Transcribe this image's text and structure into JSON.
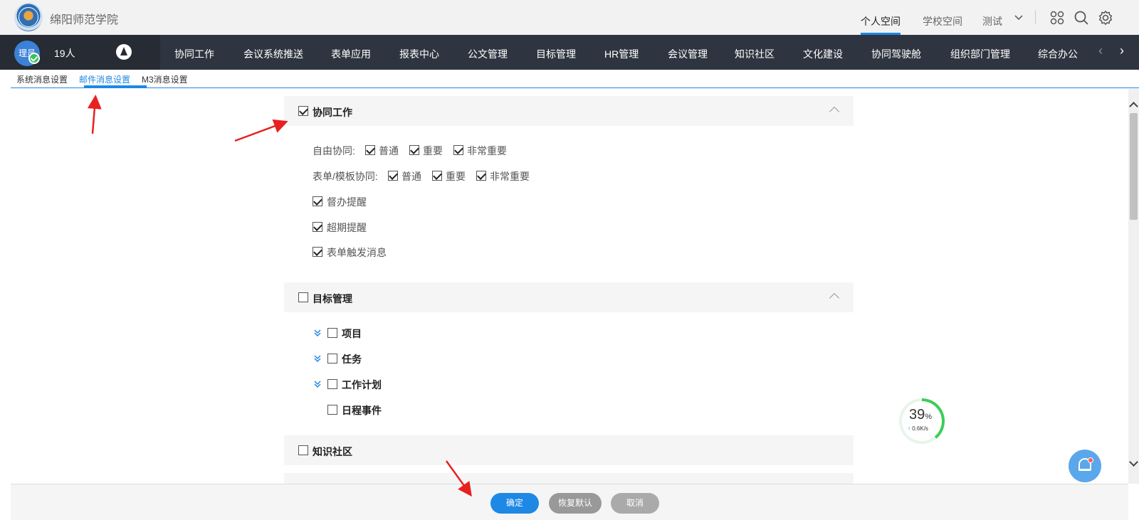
{
  "header": {
    "school_name": "绵阳师范学院",
    "links": [
      "个人空间",
      "学校空间",
      "测试"
    ]
  },
  "nav": {
    "avatar_text": "理员",
    "user_count": "19人",
    "items": [
      "协同工作",
      "会议系统推送",
      "表单应用",
      "报表中心",
      "公文管理",
      "目标管理",
      "HR管理",
      "会议管理",
      "知识社区",
      "文化建设",
      "协同驾驶舱",
      "组织部门管理",
      "综合办公"
    ]
  },
  "subtabs": [
    "系统消息设置",
    "邮件消息设置",
    "M3消息设置"
  ],
  "sections": {
    "collab": {
      "title": "协同工作",
      "free_label": "自由协同:",
      "form_label": "表单/模板协同:",
      "levels": [
        "普通",
        "重要",
        "非常重要"
      ],
      "options": [
        "督办提醒",
        "超期提醒",
        "表单触发消息"
      ]
    },
    "goal": {
      "title": "目标管理",
      "items": [
        "项目",
        "任务",
        "工作计划",
        "日程事件"
      ]
    },
    "knowledge": {
      "title": "知识社区"
    }
  },
  "footer": {
    "confirm": "确定",
    "restore": "恢复默认",
    "cancel": "取消"
  },
  "speed_widget": {
    "percent": "39",
    "percent_sign": "%",
    "rate": "0.6K/s"
  },
  "colors": {
    "accent": "#1e88e5",
    "nav_bg": "#2f3540",
    "success": "#3ccd58"
  }
}
